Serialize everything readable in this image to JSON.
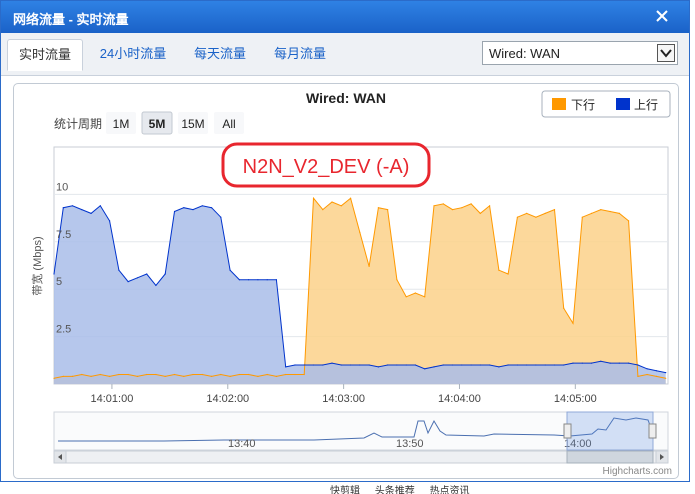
{
  "window": {
    "title": "网络流量 - 实时流量"
  },
  "tabs": [
    {
      "label": "实时流量",
      "active": true
    },
    {
      "label": "24小时流量",
      "active": false
    },
    {
      "label": "每天流量",
      "active": false
    },
    {
      "label": "每月流量",
      "active": false
    }
  ],
  "interface_select": {
    "value": "Wired: WAN"
  },
  "chart": {
    "title": "Wired: WAN",
    "watermark": "N2N_V2_DEV (-A)",
    "period_label": "统计周期",
    "period_options": [
      "1M",
      "5M",
      "15M",
      "All"
    ],
    "period_selected": "5M",
    "credits": "Highcharts.com",
    "navigator_labels": [
      "13:40",
      "13:50",
      "14:00"
    ]
  },
  "chart_data": {
    "type": "area",
    "title": "Wired: WAN",
    "ylabel": "带宽 (Mbps)",
    "ylim": [
      0,
      12.5
    ],
    "yticks": [
      "2.5",
      "5",
      "7.5",
      "10"
    ],
    "xticks": [
      "14:01:00",
      "14:02:00",
      "14:03:00",
      "14:04:00",
      "14:05:00"
    ],
    "xlim_minutes": [
      0.5,
      5.8
    ],
    "x": [
      0.5,
      0.58,
      0.66,
      0.74,
      0.82,
      0.9,
      0.98,
      1.06,
      1.14,
      1.22,
      1.3,
      1.38,
      1.46,
      1.54,
      1.62,
      1.7,
      1.78,
      1.86,
      1.94,
      2.02,
      2.1,
      2.18,
      2.26,
      2.34,
      2.42,
      2.5,
      2.58,
      2.66,
      2.74,
      2.82,
      2.9,
      2.98,
      3.06,
      3.14,
      3.22,
      3.3,
      3.38,
      3.46,
      3.54,
      3.62,
      3.7,
      3.78,
      3.86,
      3.94,
      4.02,
      4.1,
      4.18,
      4.26,
      4.34,
      4.42,
      4.5,
      4.58,
      4.66,
      4.74,
      4.82,
      4.9,
      4.98,
      5.06,
      5.14,
      5.22,
      5.3,
      5.38,
      5.46,
      5.54,
      5.62,
      5.7,
      5.78
    ],
    "series": [
      {
        "name": "下行",
        "color": "#ff9900",
        "values": [
          0.3,
          0.4,
          0.4,
          0.5,
          0.4,
          0.5,
          0.4,
          0.5,
          0.5,
          0.4,
          0.5,
          0.5,
          0.4,
          0.5,
          0.4,
          0.5,
          0.5,
          0.4,
          0.5,
          0.4,
          0.5,
          0.5,
          0.4,
          0.5,
          0.4,
          0.5,
          0.5,
          0.5,
          9.8,
          9.2,
          9.6,
          9.4,
          9.8,
          8.0,
          6.2,
          9.3,
          9.2,
          5.5,
          4.6,
          4.8,
          4.6,
          9.4,
          9.5,
          9.2,
          9.3,
          9.5,
          9.0,
          9.4,
          6.0,
          5.8,
          8.8,
          9.0,
          8.8,
          9.0,
          9.2,
          4.0,
          3.2,
          8.8,
          9.0,
          9.2,
          9.1,
          9.0,
          8.6,
          0.4,
          0.5,
          0.4,
          0.3
        ]
      },
      {
        "name": "上行",
        "color": "#0033cc",
        "values": [
          5.8,
          9.3,
          9.4,
          9.2,
          9.0,
          9.4,
          8.6,
          6.0,
          5.4,
          5.6,
          5.8,
          5.2,
          5.8,
          9.1,
          9.3,
          9.2,
          9.4,
          9.3,
          8.8,
          6.0,
          5.5,
          5.5,
          5.5,
          5.5,
          5.5,
          0.9,
          1.0,
          1.0,
          1.0,
          1.0,
          1.1,
          1.0,
          1.0,
          1.0,
          1.0,
          0.9,
          1.0,
          1.0,
          1.0,
          1.0,
          0.8,
          0.9,
          1.0,
          1.0,
          1.0,
          1.0,
          1.0,
          1.0,
          0.9,
          1.0,
          1.0,
          1.0,
          1.0,
          1.0,
          1.0,
          1.0,
          1.1,
          1.1,
          1.1,
          1.2,
          1.1,
          1.1,
          1.1,
          1.0,
          0.8,
          0.7,
          0.6
        ]
      }
    ],
    "legend_position": "top-right",
    "grid": true
  },
  "statusbar": {
    "items": [
      "快剪辑",
      "头条推荐",
      "热点资讯"
    ]
  }
}
